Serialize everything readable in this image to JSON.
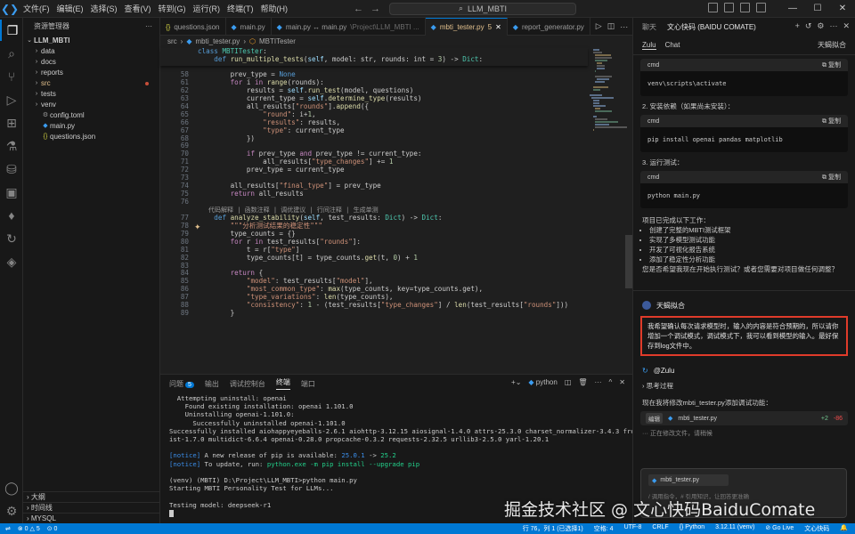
{
  "titlebar": {
    "menu": [
      "文件(F)",
      "编辑(E)",
      "选择(S)",
      "查看(V)",
      "转到(G)",
      "运行(R)",
      "终端(T)",
      "帮助(H)"
    ],
    "search": "LLM_MBTI"
  },
  "sidebar": {
    "title": "资源管理器",
    "root": "LLM_MBTI",
    "items": [
      {
        "label": "data",
        "type": "folder"
      },
      {
        "label": "docs",
        "type": "folder"
      },
      {
        "label": "reports",
        "type": "folder"
      },
      {
        "label": "src",
        "type": "folder",
        "modified": true
      },
      {
        "label": "tests",
        "type": "folder"
      },
      {
        "label": "venv",
        "type": "folder"
      },
      {
        "label": "config.toml",
        "type": "file"
      },
      {
        "label": "main.py",
        "type": "file"
      },
      {
        "label": "questions.json",
        "type": "file"
      }
    ],
    "sections": [
      "大纲",
      "时间线",
      "MYSQL"
    ]
  },
  "tabs": [
    {
      "label": "questions.json",
      "active": false
    },
    {
      "label": "main.py",
      "active": false
    },
    {
      "label": "main.py ↔ main.py",
      "sub": "\\Project\\LLM_MBTI ...",
      "active": false
    },
    {
      "label": "mbti_tester.py",
      "badge": "5",
      "active": true
    },
    {
      "label": "report_generator.py",
      "active": false
    }
  ],
  "breadcrumb": [
    "src",
    "mbti_tester.py",
    "MBTITester"
  ],
  "sticky": [
    "class MBTITester:",
    "    def run_multiple_tests(self, model: str, rounds: int = 3) -> Dict:"
  ],
  "code_lines": [
    {
      "n": "58",
      "t": "        prev_type = None"
    },
    {
      "n": "61",
      "t": "        for i in range(rounds):"
    },
    {
      "n": "62",
      "t": "            results = self.run_test(model, questions)"
    },
    {
      "n": "63",
      "t": "            current_type = self.determine_type(results)"
    },
    {
      "n": "64",
      "t": "            all_results[\"rounds\"].append({"
    },
    {
      "n": "65",
      "t": "                \"round\": i+1,"
    },
    {
      "n": "66",
      "t": "                \"results\": results,"
    },
    {
      "n": "67",
      "t": "                \"type\": current_type"
    },
    {
      "n": "68",
      "t": "            })"
    },
    {
      "n": "69",
      "t": ""
    },
    {
      "n": "70",
      "t": "            if prev_type and prev_type != current_type:"
    },
    {
      "n": "71",
      "t": "                all_results[\"type_changes\"] += 1"
    },
    {
      "n": "72",
      "t": "            prev_type = current_type"
    },
    {
      "n": "73",
      "t": ""
    },
    {
      "n": "74",
      "t": "        all_results[\"final_type\"] = prev_type"
    },
    {
      "n": "75",
      "t": "        return all_results"
    },
    {
      "n": "76",
      "t": ""
    },
    {
      "lens": "代码解释 | 函数注释 | 调优建议 | 行间注释 | 生成单测"
    },
    {
      "n": "77",
      "t": "    def analyze_stability(self, test_results: Dict) -> Dict:"
    },
    {
      "n": "78",
      "t": "        \"\"\"分析测试结果的稳定性\"\"\""
    },
    {
      "n": "79",
      "t": "        type_counts = {}"
    },
    {
      "n": "80",
      "t": "        for r in test_results[\"rounds\"]:"
    },
    {
      "n": "81",
      "t": "            t = r[\"type\"]"
    },
    {
      "n": "82",
      "t": "            type_counts[t] = type_counts.get(t, 0) + 1"
    },
    {
      "n": "83",
      "t": ""
    },
    {
      "n": "84",
      "t": "        return {"
    },
    {
      "n": "85",
      "t": "            \"model\": test_results[\"model\"],"
    },
    {
      "n": "86",
      "t": "            \"most_common_type\": max(type_counts, key=type_counts.get),"
    },
    {
      "n": "87",
      "t": "            \"type_variations\": len(type_counts),"
    },
    {
      "n": "88",
      "t": "            \"consistency\": 1 - (test_results[\"type_changes\"] / len(test_results[\"rounds\"]))"
    },
    {
      "n": "89",
      "t": "        }"
    }
  ],
  "panel": {
    "tabs": [
      "问题",
      "输出",
      "调试控制台",
      "终端",
      "端口"
    ],
    "problems_badge": "5",
    "active_tab": "终端",
    "shell": "python"
  },
  "terminal_lines": [
    {
      "t": "  Attempting uninstall: openai"
    },
    {
      "t": "    Found existing installation: openai 1.101.0"
    },
    {
      "t": "    Uninstalling openai-1.101.0:"
    },
    {
      "t": "      Successfully uninstalled openai-1.101.0"
    },
    {
      "t": "Successfully installed aiohappyeyeballs-2.6.1 aiohttp-3.12.15 aiosignal-1.4.0 attrs-25.3.0 charset_normalizer-3.4.3 frozenl"
    },
    {
      "t": "ist-1.7.0 multidict-6.6.4 openai-0.28.0 propcache-0.3.2 requests-2.32.5 urllib3-2.5.0 yarl-1.20.1"
    },
    {
      "t": ""
    },
    {
      "notice": true,
      "pre": "[notice]",
      "t": " A new release of pip is available: ",
      "a": "25.0.1",
      "arrow": " -> ",
      "b": "25.2"
    },
    {
      "notice": true,
      "pre": "[notice]",
      "t": " To update, run: ",
      "a": "python.exe -m pip install --upgrade pip",
      "arrow": "",
      "b": ""
    },
    {
      "t": ""
    },
    {
      "t": "(venv) (MBTI) D:\\Project\\LLM_MBTI>python main.py"
    },
    {
      "t": "Starting MBTI Personality Test for LLMs..."
    },
    {
      "t": ""
    },
    {
      "t": "Testing model: deepseek-r1"
    }
  ],
  "chat": {
    "top_tabs": [
      "聊天",
      "文心快码 (BAIDU COMATE)"
    ],
    "sub_tabs": [
      "Zulu",
      "Chat"
    ],
    "sub_right": "天蝎拟合",
    "cmd_label": "cmd",
    "copy_label": "复制",
    "block1": "venv\\scripts\\activate",
    "step2": "2. 安装依赖（如果尚未安装）：",
    "block2": "pip install openai pandas matplotlib",
    "step3": "3. 运行测试：",
    "block3": "python main.py",
    "done_intro": "项目已完成以下工作：",
    "done_items": [
      "创建了完整的MBTI测试框架",
      "实现了多模型测试功能",
      "开发了可视化报告系统",
      "添加了稳定性分析功能"
    ],
    "question": "您是否希望我现在开始执行测试？或者您需要对项目做任何调整？",
    "user_name": "天蝎拟合",
    "user_msg": "我希望确认每次请求模型时，输入的内容是符合预期的，所以请你增加一个调试模式，调试模式下，我可以看到模型的输入。最好保存到log文件中。",
    "bot_name": "@Zulu",
    "thinking": "思考过程",
    "reply": "现在我将修改mbti_tester.py添加调试功能：",
    "chip_tag": "编辑",
    "chip_file": "mbti_tester.py",
    "chip_add": "+2",
    "chip_del": "-86",
    "status": "正在修改文件，请稍候",
    "input_file": "mbti_tester.py",
    "input_hint": "/ 调用指令，# 引用知识，让回答更准确"
  },
  "statusbar": {
    "left": [
      "⊗ 0 △ 5",
      "⊙ 0"
    ],
    "right": [
      "行 76，列 1 (已选择1)",
      "空格: 4",
      "UTF-8",
      "CRLF",
      "{} Python",
      "3.12.11 (venv)",
      "⊘ Go Live",
      "文心快码"
    ]
  },
  "watermark": "掘金技术社区 @ 文心快码BaiduComate"
}
